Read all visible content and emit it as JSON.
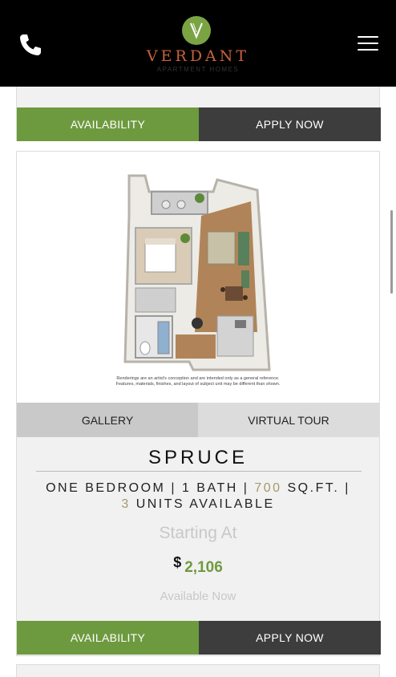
{
  "header": {
    "brand_name": "VERDANT",
    "brand_tagline": "APARTMENT HOMES",
    "logo_icon": "leaf-v-logo",
    "phone_icon": "phone-icon",
    "menu_icon": "hamburger-menu-icon",
    "brand_color": "#c8623b",
    "logo_color": "#7aa443"
  },
  "previous_card": {
    "availability_label": "AVAILABILITY",
    "apply_label": "APPLY NOW"
  },
  "unit_card": {
    "floorplan_icon": "floor-plan-rendering",
    "disclaimer_line1": "Renderings are an artist's conception and are intended only as a general reference.",
    "disclaimer_line2": "Features, materials, finishes, and layout of subject unit may be different than shown.",
    "gallery_label": "GALLERY",
    "virtual_tour_label": "VIRTUAL TOUR",
    "name": "SPRUCE",
    "beds_text": "ONE BEDROOM",
    "baths_text": "1 BATH",
    "sqft_value": "700",
    "sqft_unit": "SQ.FT.",
    "units_count": "3",
    "units_text": "UNITS AVAILABLE",
    "separator": "|",
    "starting_label": "Starting At",
    "currency_symbol": "$",
    "price": "2,106",
    "availability_text": "Available Now",
    "availability_label": "AVAILABILITY",
    "apply_label": "APPLY NOW"
  },
  "colors": {
    "accent_green": "#6e9a3f",
    "dark_button": "#3d3d3d",
    "highlight_tan": "#a59a6b"
  }
}
